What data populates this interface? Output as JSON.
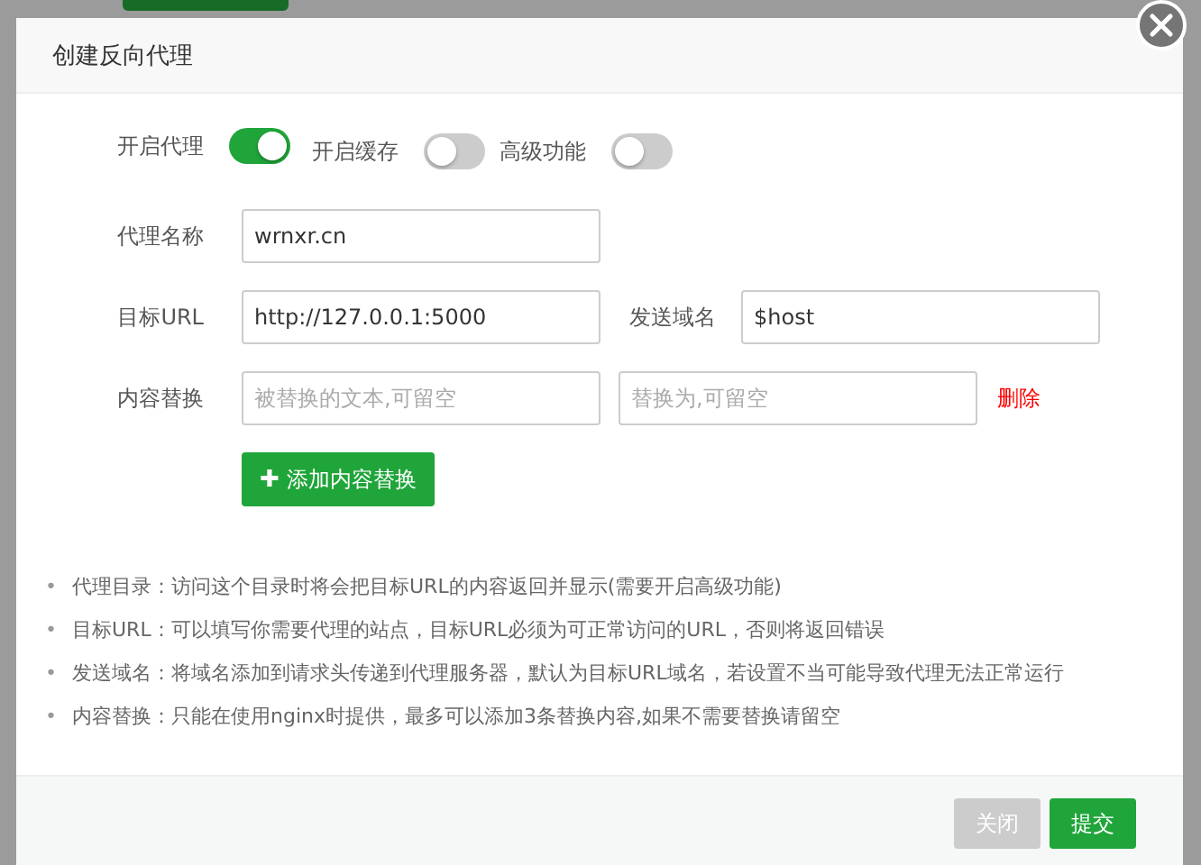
{
  "dialog": {
    "title": "创建反向代理",
    "toggles": [
      {
        "label": "开启代理",
        "on": true
      },
      {
        "label": "开启缓存",
        "on": false
      },
      {
        "label": "高级功能",
        "on": false
      }
    ],
    "name_field": {
      "label": "代理名称",
      "value": "wrnxr.cn"
    },
    "url_field": {
      "label": "目标URL",
      "value": "http://127.0.0.1:5000"
    },
    "host_field": {
      "label": "发送域名",
      "value": "$host"
    },
    "replace": {
      "label": "内容替换",
      "from_placeholder": "被替换的文本,可留空",
      "to_placeholder": "替换为,可留空",
      "delete": "删除"
    },
    "add_button": {
      "icon": "✚",
      "label": "添加内容替换"
    },
    "tips": [
      {
        "bullet": "•",
        "text": "代理目录：访问这个目录时将会把目标URL的内容返回并显示(需要开启高级功能)"
      },
      {
        "bullet": "•",
        "text": "目标URL：可以填写你需要代理的站点，目标URL必须为可正常访问的URL，否则将返回错误"
      },
      {
        "bullet": "•",
        "text": "发送域名：将域名添加到请求头传递到代理服务器，默认为目标URL域名，若设置不当可能导致代理无法正常运行"
      },
      {
        "bullet": "•",
        "text": "内容替换：只能在使用nginx时提供，最多可以添加3条替换内容,如果不需要替换请留空"
      }
    ],
    "buttons": [
      {
        "label": "关闭",
        "kind": "secondary"
      },
      {
        "label": "提交",
        "kind": "primary"
      }
    ]
  }
}
